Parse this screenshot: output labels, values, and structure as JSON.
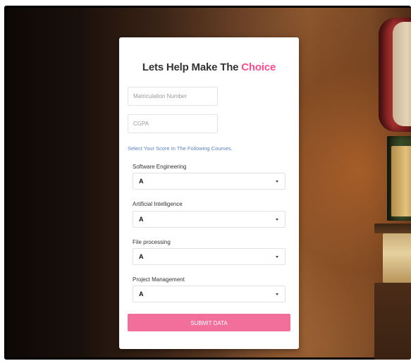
{
  "form": {
    "title_main": "Lets Help Make The ",
    "title_accent": "Choice",
    "matric_placeholder": "Matriculation Number",
    "cgpa_placeholder": "CGPA",
    "instruction": "Select Your Score In The Following Courses.",
    "courses": [
      {
        "label": "Software Engineering",
        "value": "A"
      },
      {
        "label": "Artificial Intelligence",
        "value": "A"
      },
      {
        "label": "File processing",
        "value": "A"
      },
      {
        "label": "Project Management",
        "value": "A"
      }
    ],
    "submit_label": "SUBMIT DATA"
  },
  "colors": {
    "accent": "#ff4d8d",
    "button": "#f36f9b",
    "instruction": "#5a83c6"
  }
}
